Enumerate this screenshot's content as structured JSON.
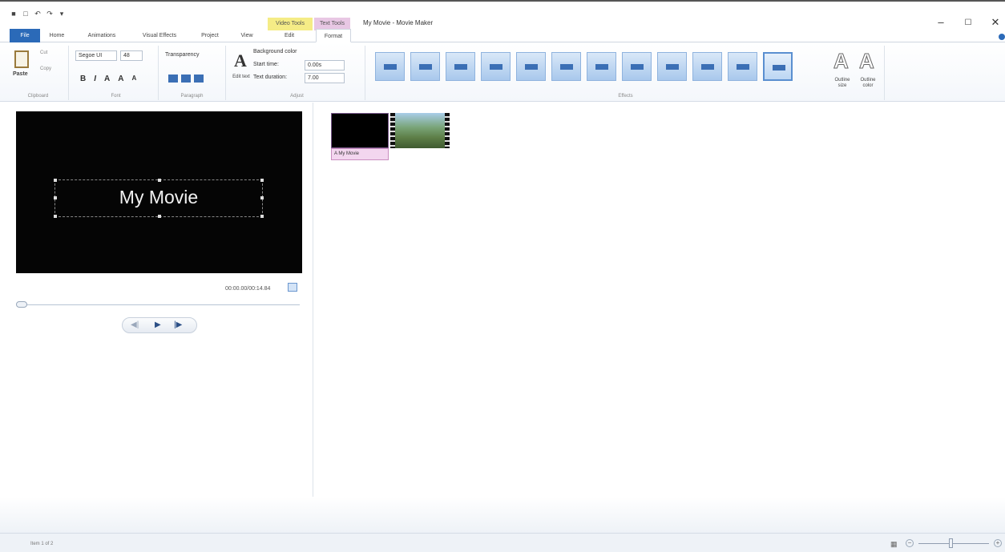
{
  "window": {
    "title": "My Movie - Movie Maker",
    "context_video": "Video Tools",
    "context_text": "Text Tools",
    "minimize": "–",
    "maximize": "☐",
    "close": "✕"
  },
  "tabs": [
    "File",
    "Home",
    "Animations",
    "Visual Effects",
    "Project",
    "View",
    "Edit",
    "Format"
  ],
  "ribbon": {
    "clipboard": {
      "paste": "Paste",
      "cut": "Cut",
      "copy": "Copy",
      "label": "Clipboard"
    },
    "font": {
      "family": "Segoe UI",
      "size": "48",
      "bold": "B",
      "italic": "I",
      "color": "A",
      "grow": "A",
      "shrink": "A",
      "label": "Font"
    },
    "paragraph": {
      "transparency": "Transparency",
      "label": "Paragraph"
    },
    "adjust": {
      "edit_text": "Edit text",
      "background_color": "Background color",
      "start_time": "Start time:",
      "start_time_value": "0.00s",
      "text_duration": "Text duration:",
      "text_duration_value": "7.00",
      "label": "Adjust"
    },
    "effects": {
      "label": "Effects",
      "count": 12,
      "selected_index": 11
    },
    "outline_size": "Outline size",
    "outline_color": "Outline color"
  },
  "preview": {
    "title_text": "My Movie",
    "timecode": "00:00.00/00:14.84"
  },
  "storyboard": {
    "title_clip_caption": "A My Movie"
  },
  "status": {
    "text": "Item 1 of 2"
  },
  "icons": {
    "save": "save-icon",
    "undo": "undo-icon",
    "redo": "redo-icon",
    "play": "play-icon",
    "prev": "previous-frame-icon",
    "next": "next-frame-icon"
  }
}
